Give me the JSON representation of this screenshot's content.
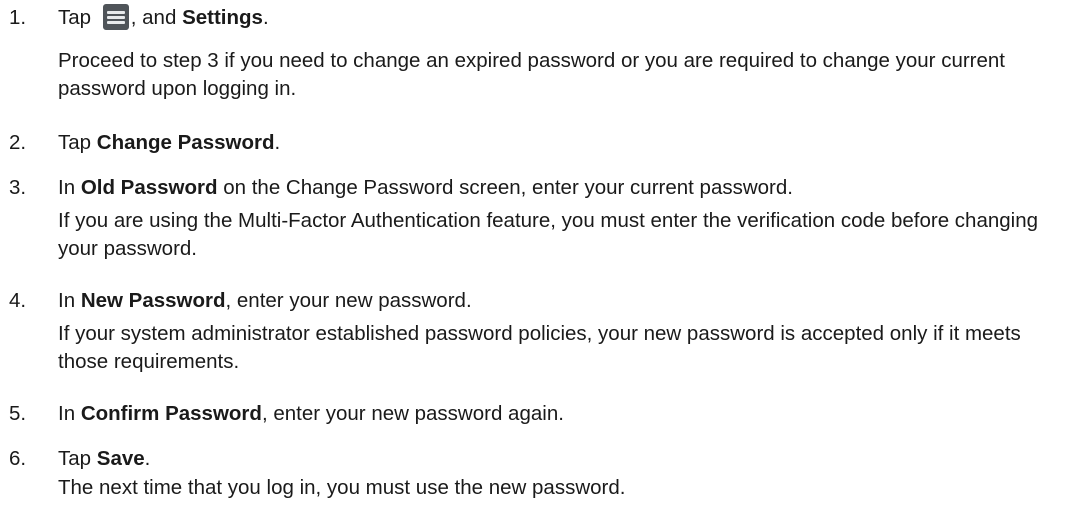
{
  "steps": [
    {
      "number": "1.",
      "tap": "Tap",
      "and": ", and",
      "settings": "Settings",
      "end": ".",
      "icon": "menu-icon",
      "note": "Proceed to step 3 if you need to change an expired password or you are required to change your current password upon logging in."
    },
    {
      "number": "2.",
      "tap": "Tap",
      "bold": "Change Password",
      "end": "."
    },
    {
      "number": "3.",
      "in": "In",
      "bold": "Old Password",
      "rest": "on the Change Password screen, enter your current password.",
      "note": "If you are using the Multi-Factor Authentication feature, you must enter the verification code before changing your password."
    },
    {
      "number": "4.",
      "in": "In",
      "bold": "New Password",
      "rest": ", enter your new password.",
      "note": "If your system administrator established password policies, your new password is accepted only if it meets those requirements."
    },
    {
      "number": "5.",
      "in": "In",
      "bold": "Confirm Password",
      "rest": ", enter your new password again."
    },
    {
      "number": "6.",
      "tap": "Tap",
      "bold": "Save",
      "end": ".",
      "result": "The next time that you log in, you must use the new password."
    }
  ]
}
